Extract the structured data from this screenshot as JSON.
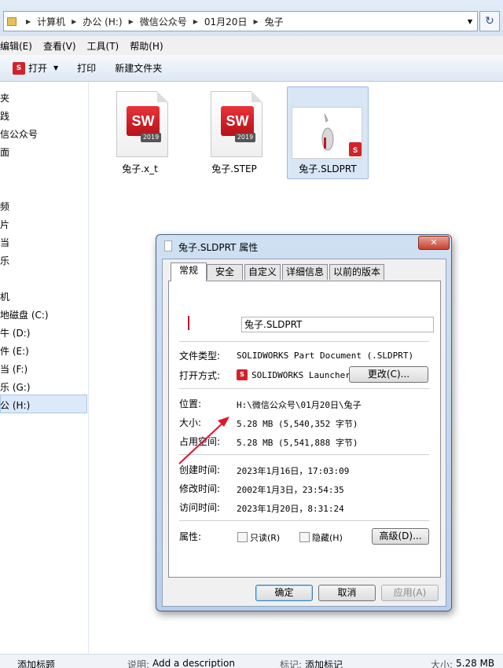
{
  "address": {
    "crumbs": [
      "计算机",
      "办公 (H:)",
      "微信公众号",
      "01月20日",
      "兔子"
    ],
    "refresh_icon": "refresh-icon"
  },
  "menubar": [
    "编辑(E)",
    "查看(V)",
    "工具(T)",
    "帮助(H)"
  ],
  "toolbar": {
    "open": "打开",
    "print": "打印",
    "new_folder": "新建文件夹"
  },
  "nav": {
    "items": [
      "夹",
      "践",
      "信公众号",
      "面",
      "",
      "频",
      "片",
      "当",
      "乐",
      "",
      "机",
      "地磁盘 (C:)",
      "牛 (D:)",
      "件 (E:)",
      "当 (F:)",
      "乐 (G:)",
      "公 (H:)"
    ]
  },
  "files": [
    {
      "name": "兔子.x_t",
      "logo": "SW",
      "year": "2019"
    },
    {
      "name": "兔子.STEP",
      "logo": "SW",
      "year": "2019"
    },
    {
      "name": "兔子.SLDPRT",
      "logo": "SW",
      "year": ""
    }
  ],
  "statusbar": {
    "tags_label": "添加标题",
    "desc_label": "说明:",
    "desc_value": "Add a description",
    "mark_label": "标记:",
    "mark_value": "添加标记",
    "size_label": "大小:",
    "size_value": "5.28 MB"
  },
  "dialog": {
    "title": "兔子.SLDPRT 属性",
    "close": "✕",
    "tabs": [
      "常规",
      "安全",
      "自定义",
      "详细信息",
      "以前的版本"
    ],
    "filename": "兔子.SLDPRT",
    "rows": {
      "type_label": "文件类型:",
      "type_value": "SOLIDWORKS Part Document (.SLDPRT)",
      "open_label": "打开方式:",
      "open_value": "SOLIDWORKS Launcher",
      "change_btn": "更改(C)...",
      "loc_label": "位置:",
      "loc_value": "H:\\微信公众号\\01月20日\\兔子",
      "size_label": "大小:",
      "size_value": "5.28 MB (5,540,352 字节)",
      "disk_label": "占用空间:",
      "disk_value": "5.28 MB (5,541,888 字节)",
      "created_label": "创建时间:",
      "created_value": "2023年1月16日，17:03:09",
      "modified_label": "修改时间:",
      "modified_value": "2002年1月3日，23:54:35",
      "accessed_label": "访问时间:",
      "accessed_value": "2023年1月20日，8:31:24",
      "attr_label": "属性:",
      "readonly": "只读(R)",
      "hidden": "隐藏(H)",
      "advanced_btn": "高级(D)..."
    },
    "ok": "确定",
    "cancel": "取消",
    "apply": "应用(A)"
  },
  "colors": {
    "annotation_arrow": "#e0142b",
    "sw_red": "#d2232a"
  }
}
